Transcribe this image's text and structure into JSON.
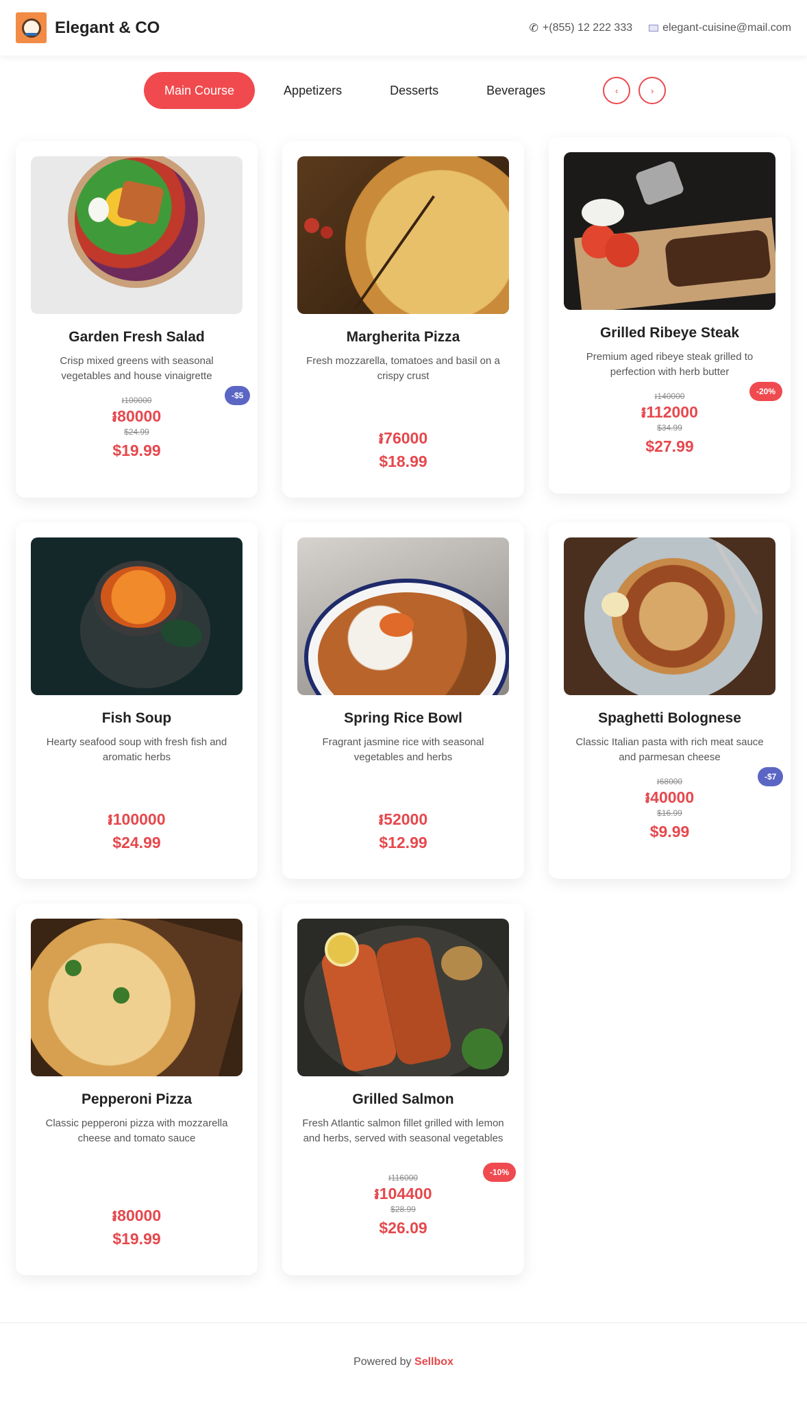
{
  "header": {
    "brand_name": "Elegant & CO",
    "phone": "+(855) 12 222 333",
    "email": "elegant-cuisine@mail.com"
  },
  "tabs": [
    {
      "label": "Main Course",
      "active": true
    },
    {
      "label": "Appetizers",
      "active": false
    },
    {
      "label": "Desserts",
      "active": false
    },
    {
      "label": "Beverages",
      "active": false
    }
  ],
  "nav": {
    "prev": "‹",
    "next": "›"
  },
  "products": [
    {
      "name": "Garden Fresh Salad",
      "description": "Crisp mixed greens with seasonal vegetables and house vinaigrette",
      "old_price_khr": "៛100000",
      "price_khr": "៛80000",
      "old_price_usd": "$24.99",
      "price_usd": "$19.99",
      "badge": "-$5"
    },
    {
      "name": "Margherita Pizza",
      "description": "Fresh mozzarella, tomatoes and basil on a crispy crust",
      "price_khr": "៛76000",
      "price_usd": "$18.99"
    },
    {
      "name": "Grilled Ribeye Steak",
      "description": "Premium aged ribeye steak grilled to perfection with herb butter",
      "old_price_khr": "៛140000",
      "price_khr": "៛112000",
      "old_price_usd": "$34.99",
      "price_usd": "$27.99",
      "badge": "-20%"
    },
    {
      "name": "Fish Soup",
      "description": "Hearty seafood soup with fresh fish and aromatic herbs",
      "price_khr": "៛100000",
      "price_usd": "$24.99"
    },
    {
      "name": "Spring Rice Bowl",
      "description": "Fragrant jasmine rice with seasonal vegetables and herbs",
      "price_khr": "៛52000",
      "price_usd": "$12.99"
    },
    {
      "name": "Spaghetti Bolognese",
      "description": "Classic Italian pasta with rich meat sauce and parmesan cheese",
      "old_price_khr": "៛68000",
      "price_khr": "៛40000",
      "old_price_usd": "$16.99",
      "price_usd": "$9.99",
      "badge": "-$7"
    },
    {
      "name": "Pepperoni Pizza",
      "description": "Classic pepperoni pizza with mozzarella cheese and tomato sauce",
      "price_khr": "៛80000",
      "price_usd": "$19.99"
    },
    {
      "name": "Grilled Salmon",
      "description": "Fresh Atlantic salmon fillet grilled with lemon and herbs, served with seasonal vegetables",
      "old_price_khr": "៛116000",
      "price_khr": "៛104400",
      "old_price_usd": "$28.99",
      "price_usd": "$26.09",
      "badge": "-10%"
    }
  ],
  "footer": {
    "prefix": "Powered by",
    "brand": "Sellbox"
  },
  "colors": {
    "accent": "#f04a4e",
    "price": "#e5484d",
    "badge_blue": "#5b66c4"
  }
}
